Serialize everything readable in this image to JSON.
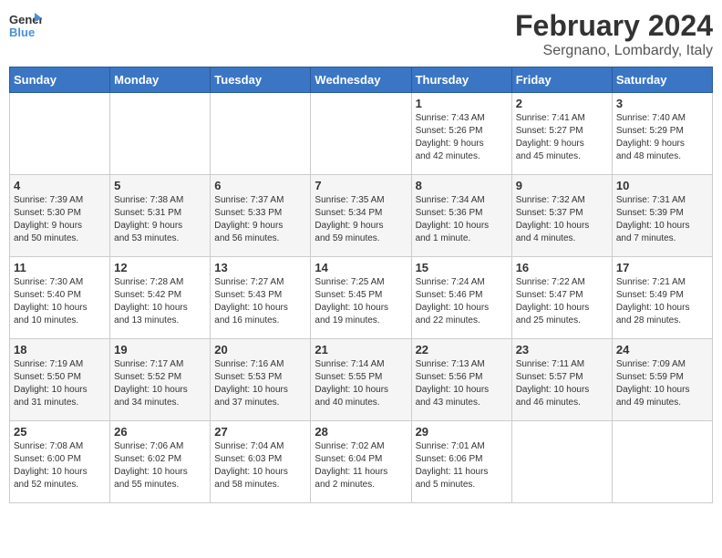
{
  "logo": {
    "line1": "General",
    "line2": "Blue"
  },
  "header": {
    "title": "February 2024",
    "subtitle": "Sergnano, Lombardy, Italy"
  },
  "weekdays": [
    "Sunday",
    "Monday",
    "Tuesday",
    "Wednesday",
    "Thursday",
    "Friday",
    "Saturday"
  ],
  "weeks": [
    [
      {
        "day": "",
        "info": ""
      },
      {
        "day": "",
        "info": ""
      },
      {
        "day": "",
        "info": ""
      },
      {
        "day": "",
        "info": ""
      },
      {
        "day": "1",
        "info": "Sunrise: 7:43 AM\nSunset: 5:26 PM\nDaylight: 9 hours\nand 42 minutes."
      },
      {
        "day": "2",
        "info": "Sunrise: 7:41 AM\nSunset: 5:27 PM\nDaylight: 9 hours\nand 45 minutes."
      },
      {
        "day": "3",
        "info": "Sunrise: 7:40 AM\nSunset: 5:29 PM\nDaylight: 9 hours\nand 48 minutes."
      }
    ],
    [
      {
        "day": "4",
        "info": "Sunrise: 7:39 AM\nSunset: 5:30 PM\nDaylight: 9 hours\nand 50 minutes."
      },
      {
        "day": "5",
        "info": "Sunrise: 7:38 AM\nSunset: 5:31 PM\nDaylight: 9 hours\nand 53 minutes."
      },
      {
        "day": "6",
        "info": "Sunrise: 7:37 AM\nSunset: 5:33 PM\nDaylight: 9 hours\nand 56 minutes."
      },
      {
        "day": "7",
        "info": "Sunrise: 7:35 AM\nSunset: 5:34 PM\nDaylight: 9 hours\nand 59 minutes."
      },
      {
        "day": "8",
        "info": "Sunrise: 7:34 AM\nSunset: 5:36 PM\nDaylight: 10 hours\nand 1 minute."
      },
      {
        "day": "9",
        "info": "Sunrise: 7:32 AM\nSunset: 5:37 PM\nDaylight: 10 hours\nand 4 minutes."
      },
      {
        "day": "10",
        "info": "Sunrise: 7:31 AM\nSunset: 5:39 PM\nDaylight: 10 hours\nand 7 minutes."
      }
    ],
    [
      {
        "day": "11",
        "info": "Sunrise: 7:30 AM\nSunset: 5:40 PM\nDaylight: 10 hours\nand 10 minutes."
      },
      {
        "day": "12",
        "info": "Sunrise: 7:28 AM\nSunset: 5:42 PM\nDaylight: 10 hours\nand 13 minutes."
      },
      {
        "day": "13",
        "info": "Sunrise: 7:27 AM\nSunset: 5:43 PM\nDaylight: 10 hours\nand 16 minutes."
      },
      {
        "day": "14",
        "info": "Sunrise: 7:25 AM\nSunset: 5:45 PM\nDaylight: 10 hours\nand 19 minutes."
      },
      {
        "day": "15",
        "info": "Sunrise: 7:24 AM\nSunset: 5:46 PM\nDaylight: 10 hours\nand 22 minutes."
      },
      {
        "day": "16",
        "info": "Sunrise: 7:22 AM\nSunset: 5:47 PM\nDaylight: 10 hours\nand 25 minutes."
      },
      {
        "day": "17",
        "info": "Sunrise: 7:21 AM\nSunset: 5:49 PM\nDaylight: 10 hours\nand 28 minutes."
      }
    ],
    [
      {
        "day": "18",
        "info": "Sunrise: 7:19 AM\nSunset: 5:50 PM\nDaylight: 10 hours\nand 31 minutes."
      },
      {
        "day": "19",
        "info": "Sunrise: 7:17 AM\nSunset: 5:52 PM\nDaylight: 10 hours\nand 34 minutes."
      },
      {
        "day": "20",
        "info": "Sunrise: 7:16 AM\nSunset: 5:53 PM\nDaylight: 10 hours\nand 37 minutes."
      },
      {
        "day": "21",
        "info": "Sunrise: 7:14 AM\nSunset: 5:55 PM\nDaylight: 10 hours\nand 40 minutes."
      },
      {
        "day": "22",
        "info": "Sunrise: 7:13 AM\nSunset: 5:56 PM\nDaylight: 10 hours\nand 43 minutes."
      },
      {
        "day": "23",
        "info": "Sunrise: 7:11 AM\nSunset: 5:57 PM\nDaylight: 10 hours\nand 46 minutes."
      },
      {
        "day": "24",
        "info": "Sunrise: 7:09 AM\nSunset: 5:59 PM\nDaylight: 10 hours\nand 49 minutes."
      }
    ],
    [
      {
        "day": "25",
        "info": "Sunrise: 7:08 AM\nSunset: 6:00 PM\nDaylight: 10 hours\nand 52 minutes."
      },
      {
        "day": "26",
        "info": "Sunrise: 7:06 AM\nSunset: 6:02 PM\nDaylight: 10 hours\nand 55 minutes."
      },
      {
        "day": "27",
        "info": "Sunrise: 7:04 AM\nSunset: 6:03 PM\nDaylight: 10 hours\nand 58 minutes."
      },
      {
        "day": "28",
        "info": "Sunrise: 7:02 AM\nSunset: 6:04 PM\nDaylight: 11 hours\nand 2 minutes."
      },
      {
        "day": "29",
        "info": "Sunrise: 7:01 AM\nSunset: 6:06 PM\nDaylight: 11 hours\nand 5 minutes."
      },
      {
        "day": "",
        "info": ""
      },
      {
        "day": "",
        "info": ""
      }
    ]
  ]
}
